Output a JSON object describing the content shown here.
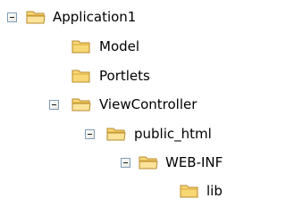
{
  "tree": {
    "nodes": [
      {
        "label": "Application1",
        "icon": "folder-open-icon",
        "expanded": true,
        "depth": 0
      },
      {
        "label": "Model",
        "icon": "folder-icon",
        "expanded": false,
        "depth": 1
      },
      {
        "label": "Portlets",
        "icon": "folder-icon",
        "expanded": false,
        "depth": 1
      },
      {
        "label": "ViewController",
        "icon": "folder-open-icon",
        "expanded": true,
        "depth": 1
      },
      {
        "label": "public_html",
        "icon": "folder-open-icon",
        "expanded": true,
        "depth": 2
      },
      {
        "label": "WEB-INF",
        "icon": "folder-open-icon",
        "expanded": true,
        "depth": 3
      },
      {
        "label": "lib",
        "icon": "folder-icon",
        "expanded": false,
        "depth": 4
      }
    ]
  },
  "colors": {
    "folder_fill": "#f8d775",
    "folder_dark": "#d9a93c",
    "folder_outline": "#b78a2a",
    "toggle_border": "#7f9db9"
  }
}
